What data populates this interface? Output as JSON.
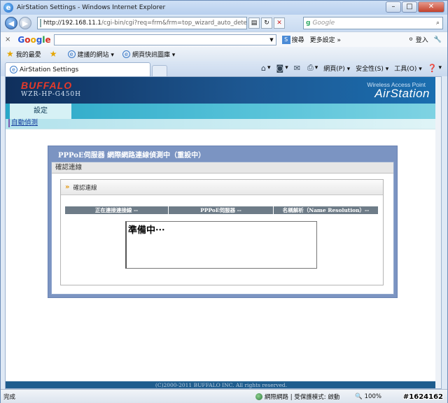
{
  "window": {
    "title": "AirStation Settings - Windows Internet Explorer",
    "minimize": "–",
    "maximize": "□",
    "close": "✕"
  },
  "address_bar": {
    "url_host": "http://192.168.11.1",
    "url_path": "/cgi-bin/cgi?req=frm&frm=top_wizard_auto_detect_"
  },
  "search_box": {
    "placeholder": "Google"
  },
  "google_toolbar": {
    "close": "×",
    "search_label": "搜尋",
    "more_label": "更多設定 »",
    "signin_label": "登入"
  },
  "favorites_bar": {
    "favorites_label": "我的最愛",
    "items": [
      "建議的網站 ▾",
      "網頁快訊圖庫 ▾"
    ]
  },
  "tabs": [
    {
      "label": "AirStation Settings"
    }
  ],
  "command_bar": {
    "page": "網頁(P) ▾",
    "safety": "安全性(S) ▾",
    "tools": "工具(O) ▾"
  },
  "header": {
    "brand": "BUFFALO",
    "model": "WZR-HP-G450H",
    "tagline": "Wireless Access Point",
    "product": "AirStation"
  },
  "menu": {
    "settings_tab": "設定",
    "sub_link": "自動偵測"
  },
  "panel": {
    "title": "PPPoE伺服器 網際網路連線偵測中（重設中）",
    "subtitle": "確認連線",
    "box_title": "確認連線",
    "columns": [
      "正在連接連接線 --",
      "PPPoE伺服器 --",
      "名稱解析（Name Resolution）--"
    ],
    "status_text": "準備中···"
  },
  "footer": {
    "copyright": "(C)2000-2011 BUFFALO INC. All rights reserved."
  },
  "status_bar": {
    "done": "完成",
    "zone": "網際網路 | 受保護模式: 啟動",
    "zoom": "🔍 100%"
  },
  "watermark": "#1624162"
}
